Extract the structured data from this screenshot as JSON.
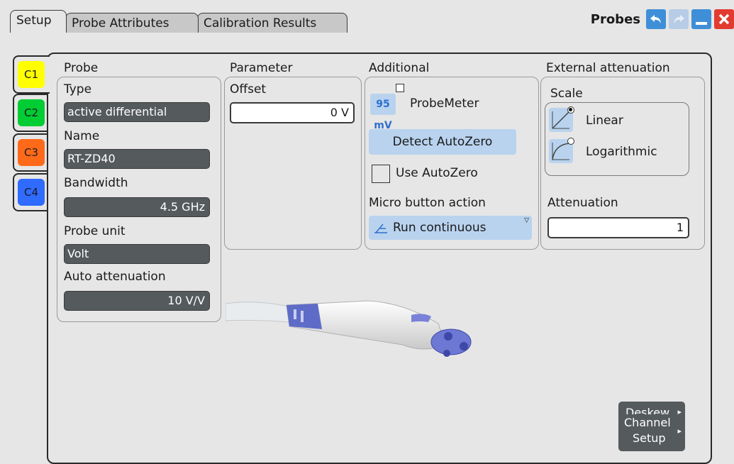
{
  "window": {
    "title": "Probes",
    "tabs": [
      "Setup",
      "Probe Attributes",
      "Calibration Results"
    ]
  },
  "channels": [
    {
      "label": "C1",
      "color": "#ffff00"
    },
    {
      "label": "C2",
      "color": "#00cc33"
    },
    {
      "label": "C3",
      "color": "#ff6a1a"
    },
    {
      "label": "C4",
      "color": "#2f6bff"
    }
  ],
  "probe": {
    "section_label": "Probe",
    "type_label": "Type",
    "type_value": "active differential",
    "name_label": "Name",
    "name_value": "RT-ZD40",
    "bandwidth_label": "Bandwidth",
    "bandwidth_value": "4.5 GHz",
    "unit_label": "Probe unit",
    "unit_value": "Volt",
    "auto_atten_label": "Auto attenuation",
    "auto_atten_value": "10 V/V"
  },
  "parameter": {
    "section_label": "Parameter",
    "offset_label": "Offset",
    "offset_value": "0 V"
  },
  "additional": {
    "section_label": "Additional",
    "probemeter_label": "ProbeMeter",
    "probemeter_icon_text": "95 mV",
    "detect_autozero_label": "Detect AutoZero",
    "use_autozero_label": "Use AutoZero",
    "micro_button_label": "Micro button action",
    "micro_button_value": "Run continuous"
  },
  "external": {
    "section_label": "External attenuation",
    "scale_label": "Scale",
    "linear_label": "Linear",
    "log_label": "Logarithmic",
    "attenuation_label": "Attenuation",
    "attenuation_value": "1"
  },
  "side_buttons": {
    "deskew": "Deskew",
    "channel_setup_line1": "Channel",
    "channel_setup_line2": "Setup"
  },
  "icons": [
    "undo-icon",
    "redo-icon",
    "minimize-icon",
    "close-icon",
    "probe-image"
  ]
}
